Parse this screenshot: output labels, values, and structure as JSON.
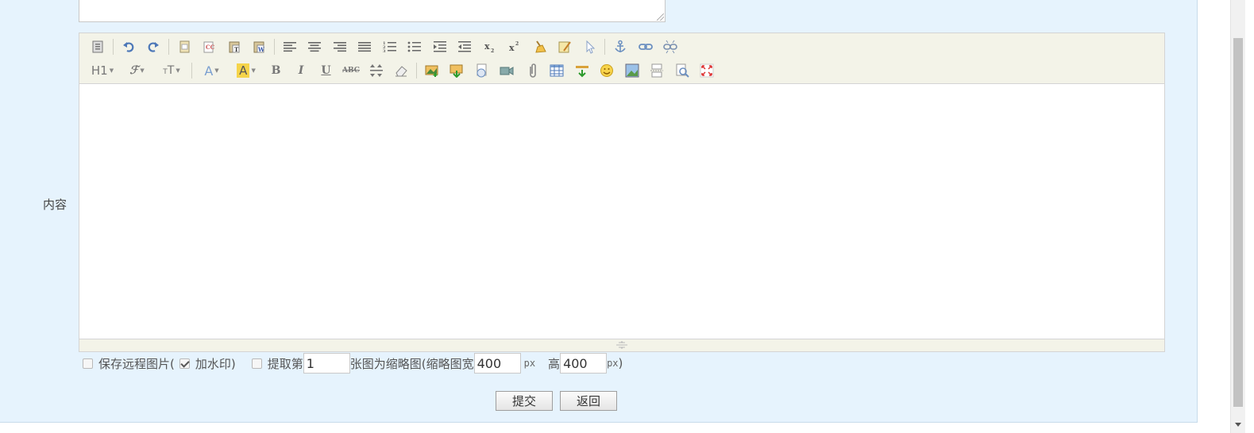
{
  "form": {
    "content_label": "内容",
    "save_remote_images_label": "保存远程图片(",
    "watermark_label": "加水印)",
    "thumbnail_prefix": "提取第",
    "thumbnail_index": "1",
    "thumbnail_middle": "张图为缩略图(缩略图宽",
    "thumbnail_width": "400",
    "unit_px": "px",
    "height_label": "高",
    "thumbnail_height": "400",
    "close_paren": ")",
    "options": {
      "save_remote_images": false,
      "watermark": true,
      "extract_thumbnail": false
    }
  },
  "buttons": {
    "submit": "提交",
    "back": "返回"
  },
  "toolbar": {
    "heading": "H1",
    "bold": "B",
    "italic": "I",
    "underline": "U",
    "strikethrough": "ABC"
  },
  "colors": {
    "panel_bg": "#e6f3fd",
    "toolbar_bg": "#f3f3e8"
  }
}
